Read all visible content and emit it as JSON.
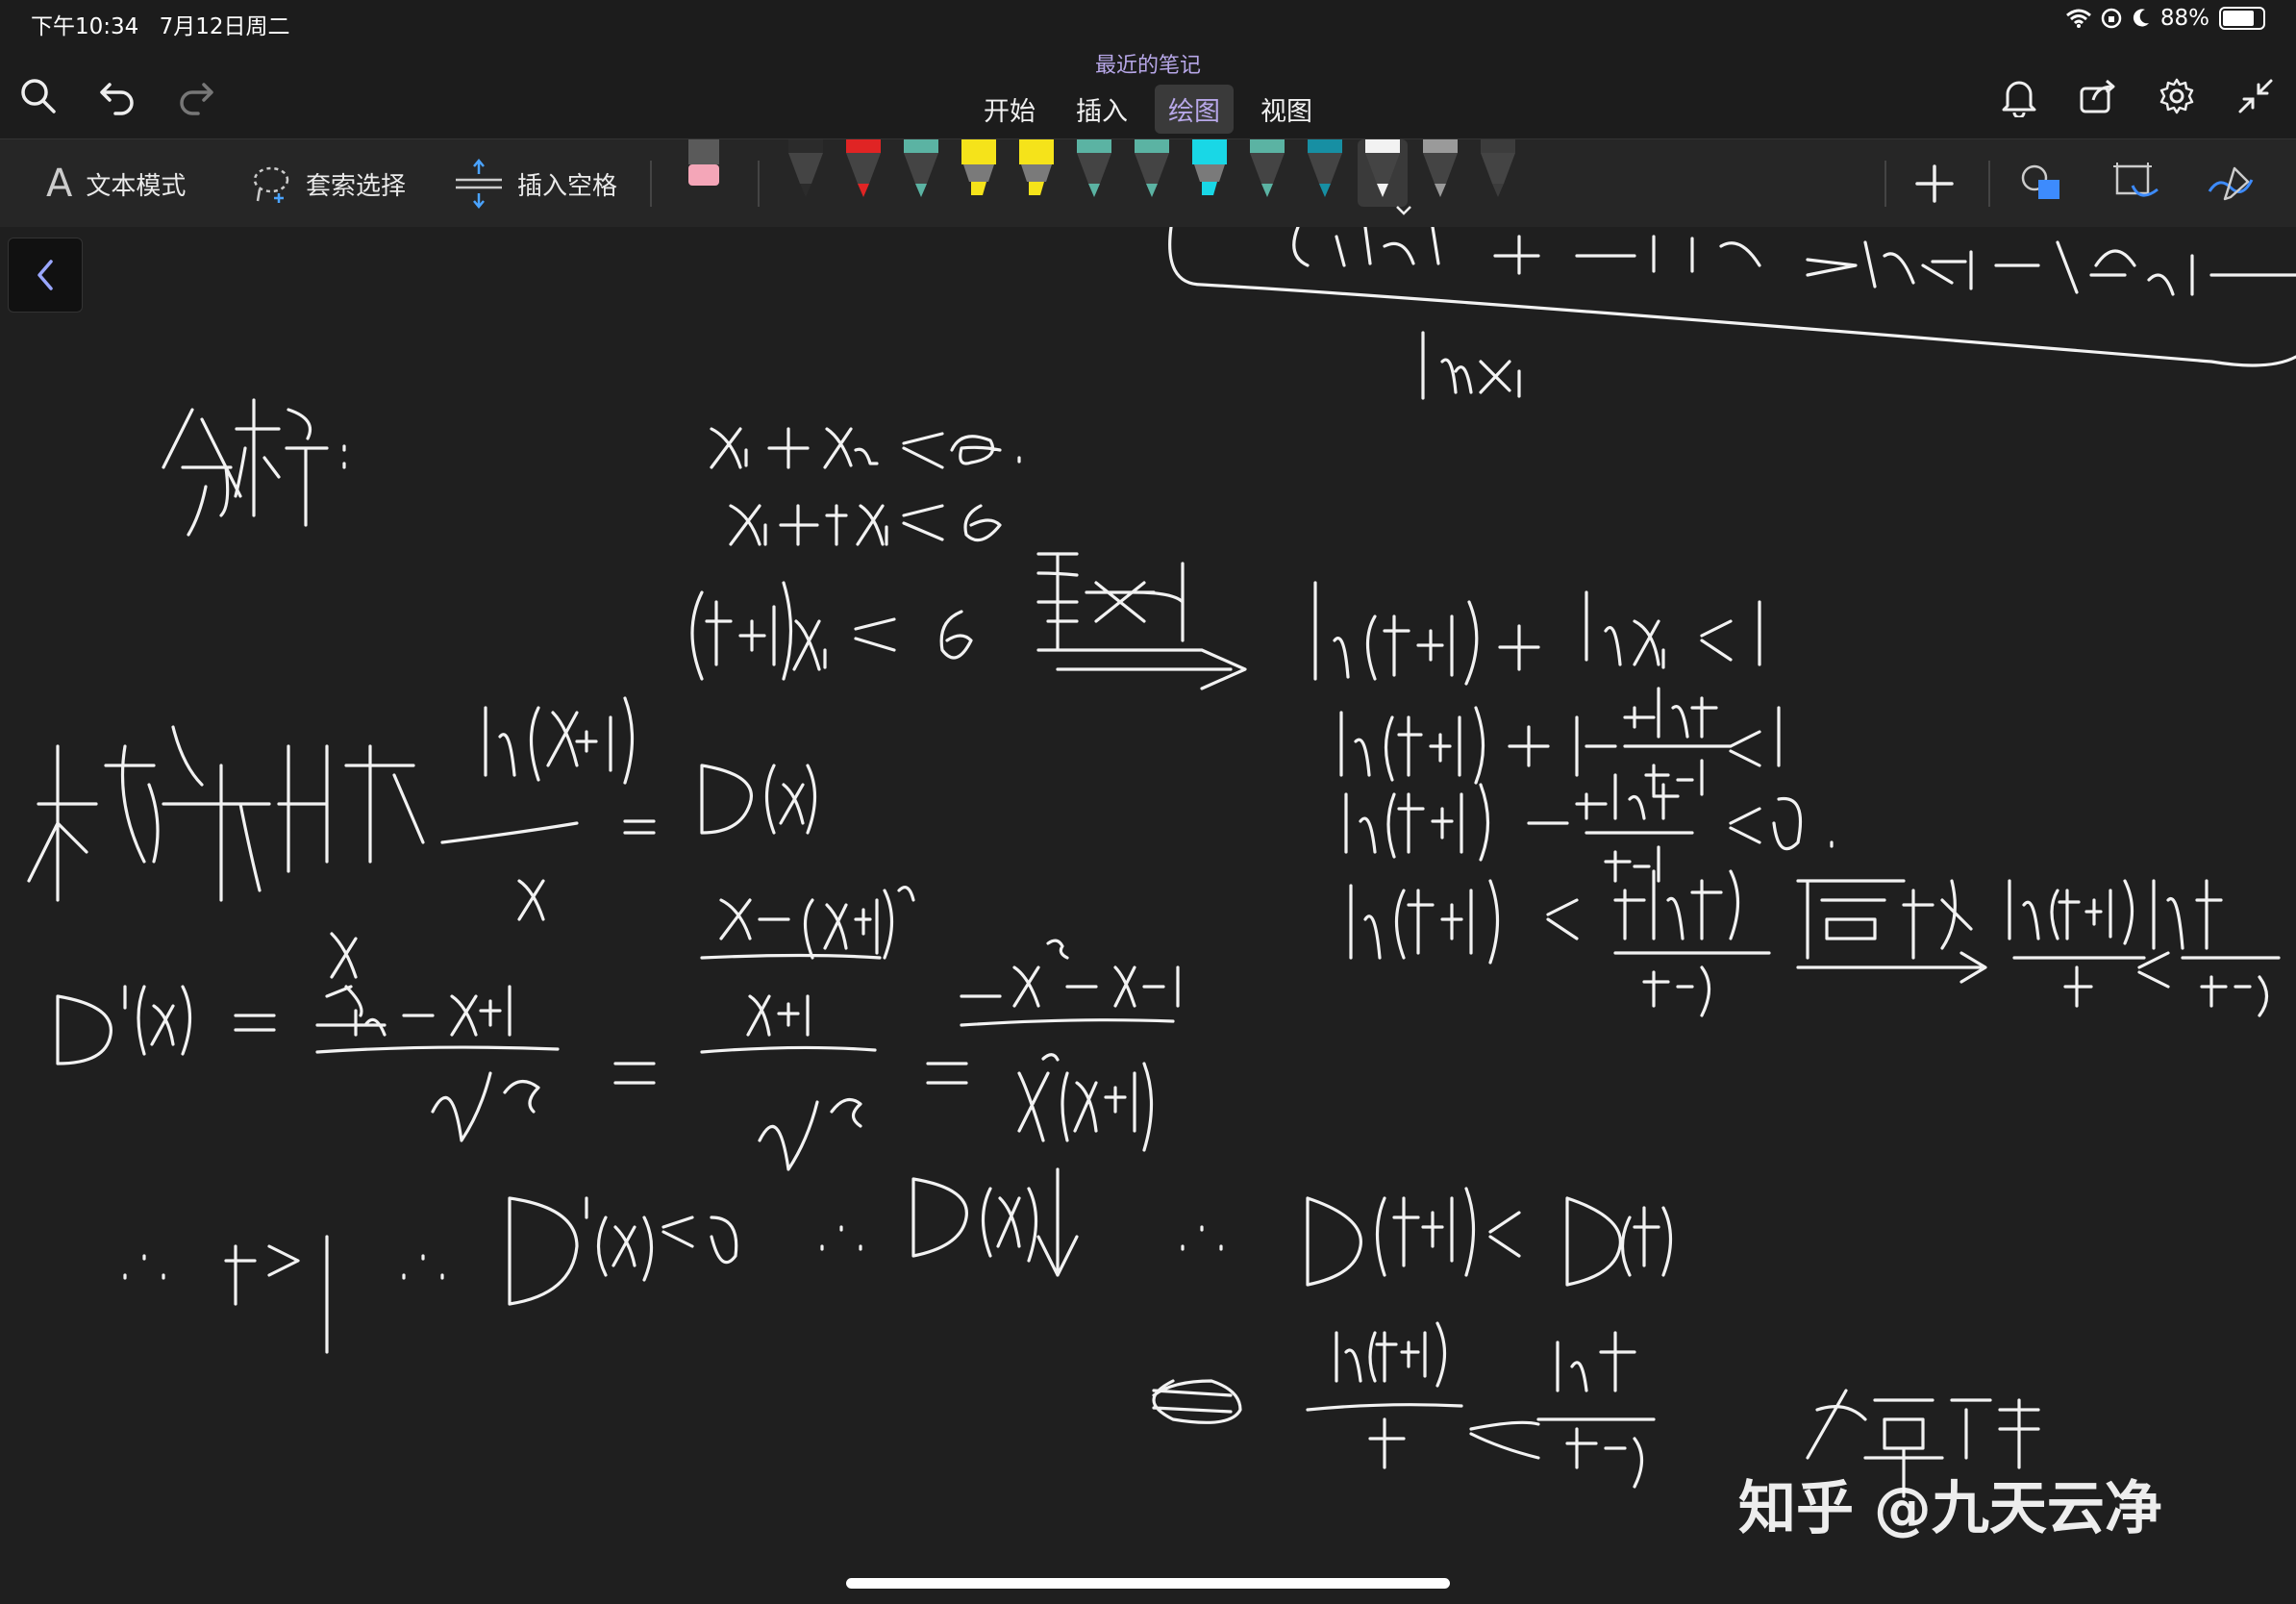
{
  "status": {
    "time": "下午10:34",
    "date": "7月12日周二",
    "battery": "88%",
    "battery_level": 0.88
  },
  "title": "最近的笔记",
  "tabs": [
    {
      "label": "开始"
    },
    {
      "label": "插入"
    },
    {
      "label": "绘图"
    },
    {
      "label": "视图"
    }
  ],
  "ribbon": {
    "text_mode": "文本模式",
    "lasso": "套索选择",
    "insert_space": "插入空格"
  },
  "pens": [
    {
      "kind": "eraser",
      "color": "#f4a6b8"
    },
    {
      "kind": "pen",
      "color": "#2b2b2b"
    },
    {
      "kind": "pen",
      "color": "#e02424"
    },
    {
      "kind": "pen",
      "color": "#5bb3a3"
    },
    {
      "kind": "highlighter",
      "color": "#f5e31a"
    },
    {
      "kind": "highlighter",
      "color": "#f5e31a"
    },
    {
      "kind": "pen",
      "color": "#5bb3a3"
    },
    {
      "kind": "pen",
      "color": "#5bb3a3"
    },
    {
      "kind": "highlighter",
      "color": "#19d7e6"
    },
    {
      "kind": "pen",
      "color": "#5bb3a3"
    },
    {
      "kind": "pen",
      "color": "#178fa3"
    },
    {
      "kind": "pen",
      "color": "#f2f2f2",
      "selected": true
    },
    {
      "kind": "pen",
      "color": "#9a9a9a"
    },
    {
      "kind": "pen",
      "color": "#3c3c3c"
    }
  ],
  "accent": "#b7a7e8",
  "watermark": "知乎 @九天云净"
}
